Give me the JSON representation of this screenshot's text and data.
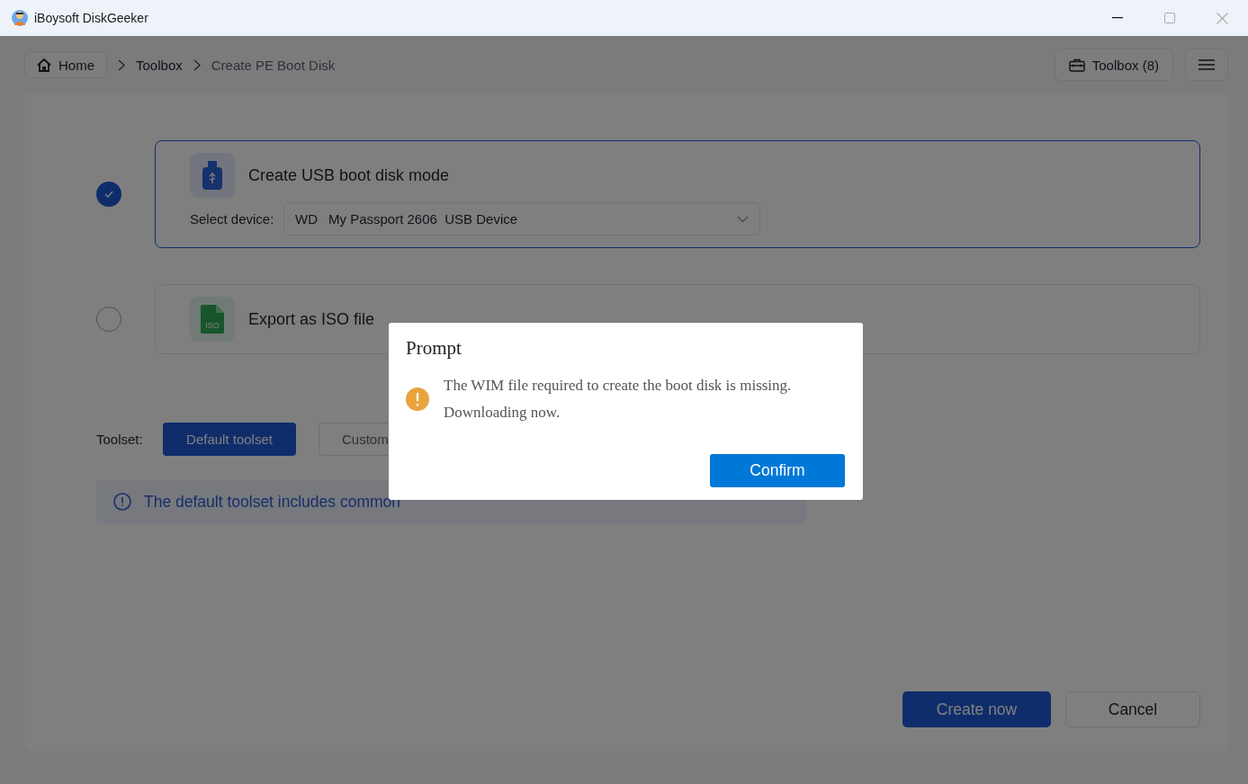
{
  "window": {
    "title": "iBoysoft DiskGeeker"
  },
  "breadcrumb": [
    {
      "label": "Home",
      "kind": "home"
    },
    {
      "label": "Toolbox",
      "kind": "link"
    },
    {
      "label": "Create PE Boot Disk",
      "kind": "current"
    }
  ],
  "toolbox_button": {
    "label": "Toolbox",
    "count": "(8)"
  },
  "modes": [
    {
      "title": "Create USB boot disk mode",
      "kind": "usb",
      "selected": true,
      "device_label": "Select device:",
      "device": {
        "vendor": "WD",
        "name": "My Passport 2606  USB Device"
      }
    },
    {
      "title": "Export as ISO file",
      "kind": "iso",
      "selected": false,
      "icon_label": "ISO"
    }
  ],
  "toolset": {
    "label": "Toolset:",
    "options": [
      {
        "label": "Default toolset",
        "selected": true
      },
      {
        "label": "Custom",
        "selected": false
      }
    ]
  },
  "info": "The default toolset includes common",
  "actions": [
    {
      "label": "Create now",
      "kind": "primary"
    },
    {
      "label": "Cancel",
      "kind": "secondary"
    }
  ],
  "dialog": {
    "title": "Prompt",
    "message": "The WIM file required to create the boot disk is missing. Downloading now.",
    "button": "Confirm"
  }
}
